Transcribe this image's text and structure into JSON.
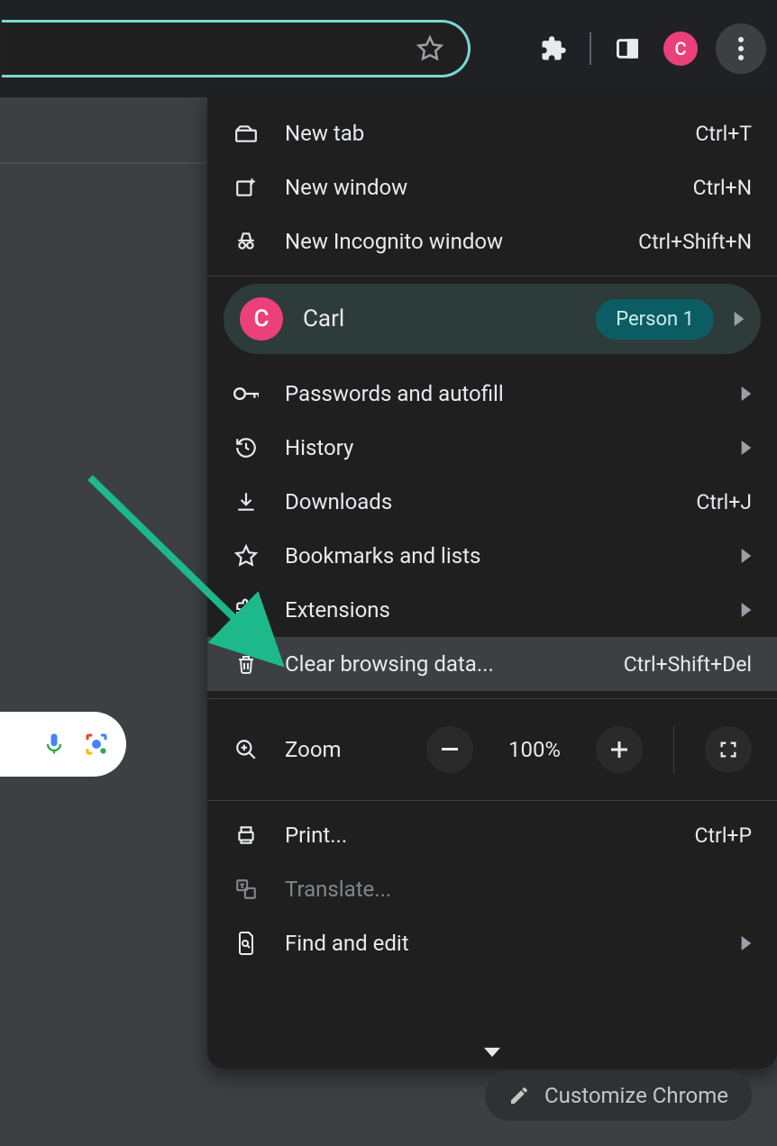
{
  "toolbar": {
    "profile_initial": "C"
  },
  "menu": {
    "new_tab": {
      "label": "New tab",
      "shortcut": "Ctrl+T"
    },
    "new_window": {
      "label": "New window",
      "shortcut": "Ctrl+N"
    },
    "new_incognito": {
      "label": "New Incognito window",
      "shortcut": "Ctrl+Shift+N"
    },
    "profile": {
      "initial": "C",
      "name": "Carl",
      "badge": "Person 1"
    },
    "passwords": {
      "label": "Passwords and autofill"
    },
    "history": {
      "label": "History"
    },
    "downloads": {
      "label": "Downloads",
      "shortcut": "Ctrl+J"
    },
    "bookmarks": {
      "label": "Bookmarks and lists"
    },
    "extensions": {
      "label": "Extensions"
    },
    "clear_data": {
      "label": "Clear browsing data...",
      "shortcut": "Ctrl+Shift+Del"
    },
    "zoom": {
      "label": "Zoom",
      "value": "100%"
    },
    "print": {
      "label": "Print...",
      "shortcut": "Ctrl+P"
    },
    "translate": {
      "label": "Translate..."
    },
    "find_edit": {
      "label": "Find and edit"
    }
  },
  "customize_button": "Customize Chrome",
  "annotation": {
    "target": "clear_data"
  }
}
